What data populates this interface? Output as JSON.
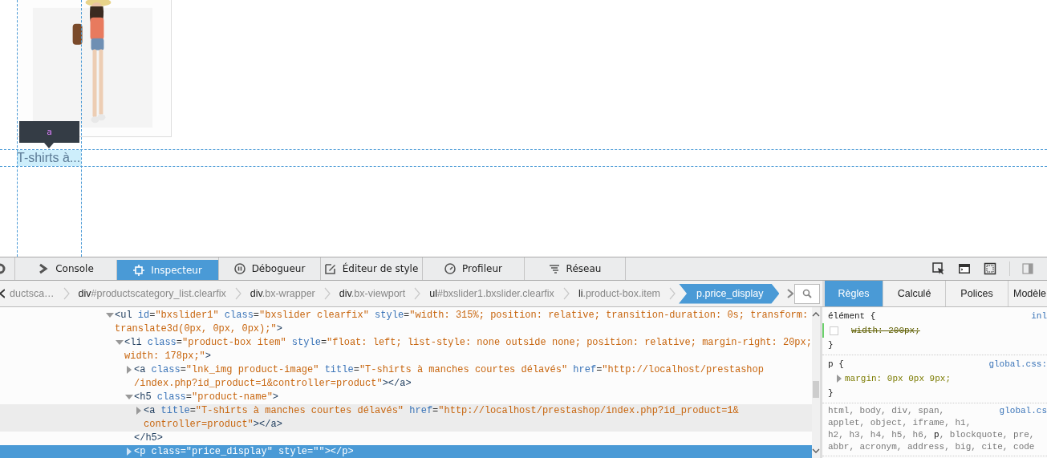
{
  "page": {
    "tooltip": "a",
    "product_name": "T-shirts à..."
  },
  "toolbar": {
    "tabs": [
      {
        "label": "Console",
        "kind": "console",
        "selected": false
      },
      {
        "label": "Inspecteur",
        "kind": "inspector",
        "selected": true
      },
      {
        "label": "Débogueur",
        "kind": "debugger",
        "selected": false
      },
      {
        "label": "Éditeur de style",
        "kind": "style",
        "selected": false
      },
      {
        "label": "Profileur",
        "kind": "profiler",
        "selected": false
      },
      {
        "label": "Réseau",
        "kind": "network",
        "selected": false
      }
    ]
  },
  "breadcrumbs": [
    {
      "rest": "ductsca…",
      "selected": false
    },
    {
      "tag": "div",
      "rest": "#productscategory_list.clearfix",
      "selected": false
    },
    {
      "tag": "div",
      "rest": ".bx-wrapper",
      "selected": false
    },
    {
      "tag": "div",
      "rest": ".bx-viewport",
      "selected": false
    },
    {
      "tag": "ul",
      "rest": "#bxslider1.bxslider.clearfix",
      "selected": false
    },
    {
      "tag": "li",
      "rest": ".product-box.item",
      "selected": false
    },
    {
      "tag": "p",
      "rest": ".price_display",
      "selected": true
    }
  ],
  "markup": [
    {
      "expanded": true,
      "selected": false,
      "hovered": false,
      "lines": [
        [
          {
            "kind": "tag",
            "text": "<ul "
          },
          {
            "kind": "attr",
            "text": "id"
          },
          {
            "kind": "punct",
            "text": "="
          },
          {
            "kind": "value",
            "text": "\"bxslider1\" "
          },
          {
            "kind": "attr",
            "text": "class"
          },
          {
            "kind": "punct",
            "text": "="
          },
          {
            "kind": "value",
            "text": "\"bxslider clearfix\" "
          },
          {
            "kind": "attr",
            "text": "style"
          },
          {
            "kind": "punct",
            "text": "="
          },
          {
            "kind": "value",
            "text": "\"width: 315%; position: relative; transition-duration: 0s; transform:"
          }
        ],
        [
          {
            "kind": "value",
            "text": "translate3d(0px, 0px, 0px);\""
          },
          {
            "kind": "tag",
            "text": ">"
          }
        ]
      ],
      "children": [
        {
          "expanded": true,
          "selected": false,
          "hovered": false,
          "lines": [
            [
              {
                "kind": "tag",
                "text": "<li "
              },
              {
                "kind": "attr",
                "text": "class"
              },
              {
                "kind": "punct",
                "text": "="
              },
              {
                "kind": "value",
                "text": "\"product-box item\" "
              },
              {
                "kind": "attr",
                "text": "style"
              },
              {
                "kind": "punct",
                "text": "="
              },
              {
                "kind": "value",
                "text": "\"float: left; list-style: none outside none; position: relative; margin-right: 20px;"
              }
            ],
            [
              {
                "kind": "value",
                "text": "width: 178px;\""
              },
              {
                "kind": "tag",
                "text": ">"
              }
            ]
          ],
          "children": [
            {
              "expanded": false,
              "selected": false,
              "hovered": false,
              "lines": [
                [
                  {
                    "kind": "tag",
                    "text": "<a "
                  },
                  {
                    "kind": "attr",
                    "text": "class"
                  },
                  {
                    "kind": "punct",
                    "text": "="
                  },
                  {
                    "kind": "value",
                    "text": "\"lnk_img product-image\" "
                  },
                  {
                    "kind": "attr",
                    "text": "title"
                  },
                  {
                    "kind": "punct",
                    "text": "="
                  },
                  {
                    "kind": "value",
                    "text": "\"T-shirts à manches courtes délavés\" "
                  },
                  {
                    "kind": "attr",
                    "text": "href"
                  },
                  {
                    "kind": "punct",
                    "text": "="
                  },
                  {
                    "kind": "value",
                    "text": "\"http://localhost/prestashop"
                  }
                ],
                [
                  {
                    "kind": "value",
                    "text": "/index.php?id_product=1&controller=product\""
                  },
                  {
                    "kind": "tag",
                    "text": "></a>"
                  }
                ]
              ]
            },
            {
              "expanded": true,
              "selected": false,
              "hovered": false,
              "lines": [
                [
                  {
                    "kind": "tag",
                    "text": "<h5 "
                  },
                  {
                    "kind": "attr",
                    "text": "class"
                  },
                  {
                    "kind": "punct",
                    "text": "="
                  },
                  {
                    "kind": "value",
                    "text": "\"product-name\""
                  },
                  {
                    "kind": "tag",
                    "text": ">"
                  }
                ]
              ],
              "closing": [
                {
                  "kind": "tag",
                  "text": "</h5>"
                }
              ],
              "children": [
                {
                  "expanded": false,
                  "selected": false,
                  "hovered": true,
                  "lines": [
                    [
                      {
                        "kind": "tag",
                        "text": "<a "
                      },
                      {
                        "kind": "attr",
                        "text": "title"
                      },
                      {
                        "kind": "punct",
                        "text": "="
                      },
                      {
                        "kind": "value",
                        "text": "\"T-shirts à manches courtes délavés\" "
                      },
                      {
                        "kind": "attr",
                        "text": "href"
                      },
                      {
                        "kind": "punct",
                        "text": "="
                      },
                      {
                        "kind": "value",
                        "text": "\"http://localhost/prestashop/index.php?id_product=1&"
                      }
                    ],
                    [
                      {
                        "kind": "value",
                        "text": "controller=product\""
                      },
                      {
                        "kind": "tag",
                        "text": "></a>"
                      }
                    ]
                  ]
                }
              ]
            },
            {
              "expanded": false,
              "selected": true,
              "hovered": false,
              "lines": [
                [
                  {
                    "kind": "tag",
                    "text": "<p "
                  },
                  {
                    "kind": "attr",
                    "text": "class"
                  },
                  {
                    "kind": "punct",
                    "text": "="
                  },
                  {
                    "kind": "value",
                    "text": "\"price_display\" "
                  },
                  {
                    "kind": "attr",
                    "text": "style"
                  },
                  {
                    "kind": "punct",
                    "text": "="
                  },
                  {
                    "kind": "value",
                    "text": "\"\""
                  },
                  {
                    "kind": "tag",
                    "text": "></p>"
                  }
                ]
              ]
            }
          ]
        }
      ]
    }
  ],
  "sidebar": {
    "tabs": [
      {
        "label": "Règles",
        "selected": true
      },
      {
        "label": "Calculé",
        "selected": false
      },
      {
        "label": "Polices",
        "selected": false
      },
      {
        "label": "Modèle",
        "selected": false
      }
    ],
    "rules": [
      {
        "selector": "élément {",
        "source": "inl",
        "declarations": [
          {
            "text": "width: 200px;",
            "enabled": false,
            "overridden": true,
            "expandable": false
          }
        ],
        "close": "}"
      },
      {
        "selector": "p {",
        "source": "global.css:",
        "declarations": [
          {
            "text": "margin: 0px 0px 9px;",
            "enabled": true,
            "overridden": false,
            "expandable": true
          }
        ],
        "close": "}"
      },
      {
        "selector_lines": [
          "html, body, div, span,",
          "applet, object, iframe, h1,",
          "h2, h3, h4, h5, h6, **p**, blockquote, pre,",
          "abbr, acronym, address, big, cite, code"
        ],
        "source": "global.cs"
      }
    ]
  }
}
